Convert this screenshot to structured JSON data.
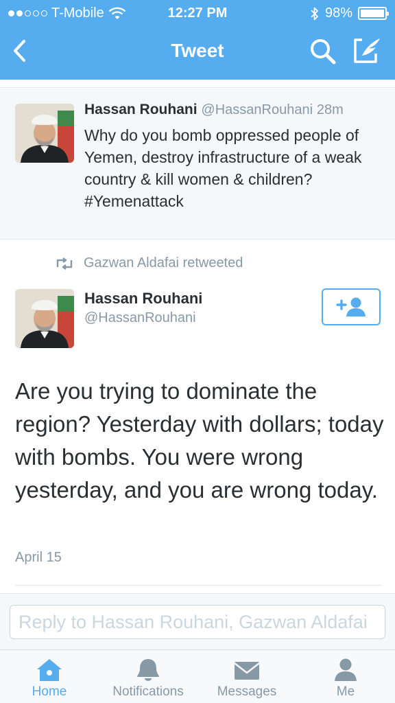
{
  "status_bar": {
    "carrier": "T-Mobile",
    "time": "12:27 PM",
    "battery": "98%",
    "battery_level": 0.98
  },
  "nav": {
    "title": "Tweet",
    "back_icon": "chevron-left-icon",
    "search_icon": "search-icon",
    "compose_icon": "compose-icon"
  },
  "parent_tweet": {
    "name": "Hassan Rouhani",
    "handle": "@HassanRouhani",
    "time": "28m",
    "text": "Why do you bomb oppressed people of Yemen, destroy infrastructure of a weak country & kill women & children? #Yemenattack"
  },
  "main_tweet": {
    "retweeted_by": "Gazwan Aldafai retweeted",
    "name": "Hassan Rouhani",
    "handle": "@HassanRouhani",
    "text": "Are you trying to dominate the region? Yesterday with dollars; today with bombs. You were wrong yesterday, and you are wrong today.",
    "date": "April 15"
  },
  "reply": {
    "placeholder": "Reply to Hassan Rouhani, Gazwan Aldafai"
  },
  "tabs": [
    {
      "label": "Home",
      "icon": "home-icon",
      "active": true
    },
    {
      "label": "Notifications",
      "icon": "bell-icon",
      "active": false
    },
    {
      "label": "Messages",
      "icon": "envelope-icon",
      "active": false
    },
    {
      "label": "Me",
      "icon": "person-icon",
      "active": false
    }
  ],
  "colors": {
    "brand": "#55acee",
    "text": "#292f33",
    "muted": "#8899a6"
  }
}
